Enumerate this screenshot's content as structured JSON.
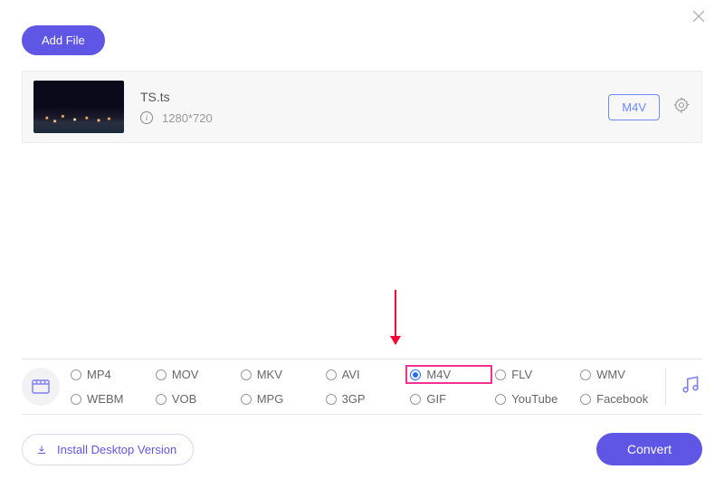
{
  "header": {
    "add_file_label": "Add File"
  },
  "file": {
    "name": "TS.ts",
    "resolution": "1280*720",
    "target_format": "M4V"
  },
  "formats": {
    "row1": [
      "MP4",
      "MOV",
      "MKV",
      "AVI",
      "M4V",
      "FLV",
      "WMV"
    ],
    "row2": [
      "WEBM",
      "VOB",
      "MPG",
      "3GP",
      "GIF",
      "YouTube",
      "Facebook"
    ],
    "selected": "M4V",
    "highlighted": "M4V"
  },
  "footer": {
    "install_label": "Install Desktop Version",
    "convert_label": "Convert"
  },
  "colors": {
    "primary": "#6056e6",
    "highlight": "#f5318f",
    "arrow": "#ff0033"
  }
}
